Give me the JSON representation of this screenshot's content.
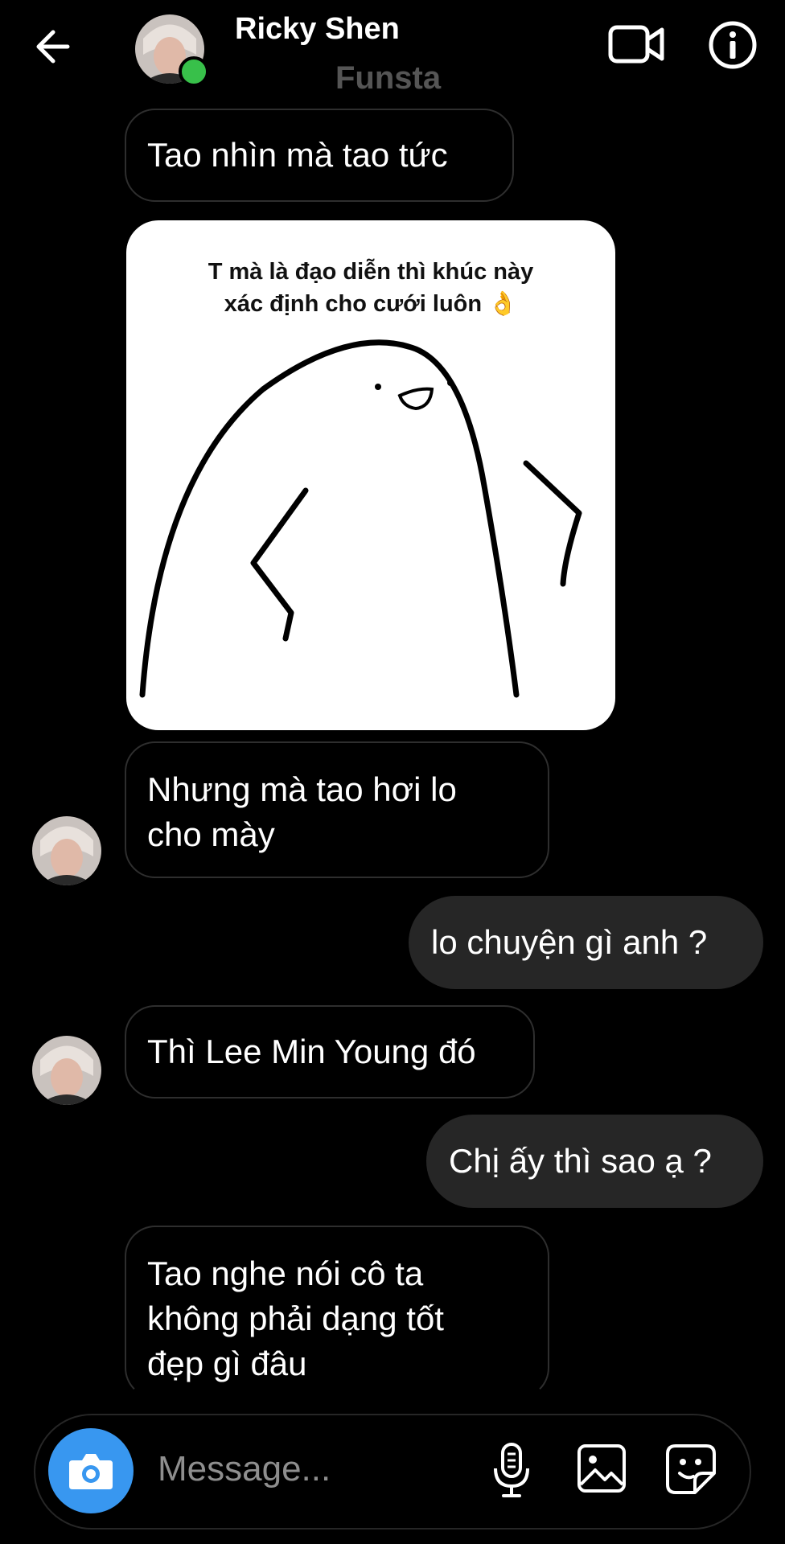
{
  "header": {
    "name": "Ricky Shen",
    "subtitle": "Funsta"
  },
  "messages": [
    {
      "from": "them",
      "text": "Tao nhìn mà tao tức"
    },
    {
      "from": "them",
      "type": "sticker",
      "caption_line1": "T mà là đạo diễn thì khúc này",
      "caption_line2": "xác định cho cưới luôn 👌"
    },
    {
      "from": "them",
      "line1": "Nhưng mà tao hơi lo",
      "line2": "cho mày"
    },
    {
      "from": "me",
      "text": "lo chuyện gì anh ?"
    },
    {
      "from": "them",
      "text": "Thì Lee Min Young đó"
    },
    {
      "from": "me",
      "text": "Chị ấy thì sao ạ ?"
    },
    {
      "from": "them",
      "line1": "Tao nghe nói cô ta",
      "line2": "không phải dạng tốt",
      "line3": "đẹp gì đâu"
    }
  ],
  "composer": {
    "placeholder": "Message..."
  },
  "colors": {
    "accent": "#3897f0",
    "online": "#38c04a",
    "outgoing_bubble": "#262626",
    "incoming_border": "#2e2e2e"
  },
  "icons": [
    "back-arrow-icon",
    "video-call-icon",
    "info-icon",
    "camera-icon",
    "microphone-icon",
    "gallery-icon",
    "sticker-icon"
  ]
}
